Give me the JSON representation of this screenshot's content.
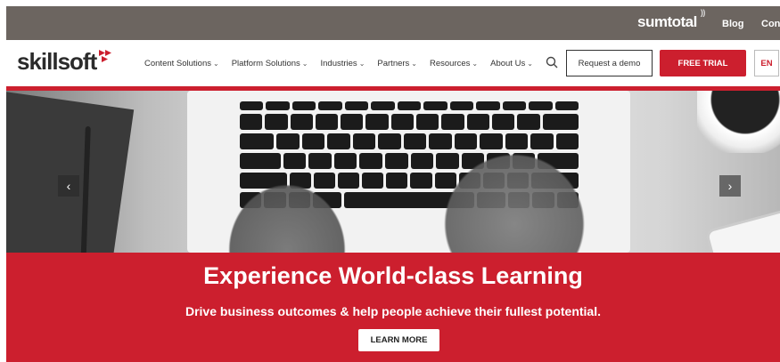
{
  "topbar": {
    "brand": "sumtotal",
    "brand_mark": "))",
    "links": [
      "Blog",
      "Contac"
    ]
  },
  "nav": {
    "logo": "skillsoft",
    "items": [
      {
        "label": "Content Solutions"
      },
      {
        "label": "Platform Solutions"
      },
      {
        "label": "Industries"
      },
      {
        "label": "Partners"
      },
      {
        "label": "Resources"
      },
      {
        "label": "About Us"
      }
    ],
    "chevron": "⌄",
    "search_icon": "search-icon",
    "demo_label": "Request a demo",
    "trial_label": "FREE TRIAL",
    "lang_label": "EN"
  },
  "hero": {
    "prev_glyph": "‹",
    "next_glyph": "›"
  },
  "banner": {
    "headline": "Experience World-class Learning",
    "subline": "Drive business outcomes & help people achieve their fullest potential.",
    "cta": "LEARN MORE"
  },
  "colors": {
    "brand_red": "#cc1f2e",
    "topbar": "#6c6560"
  }
}
